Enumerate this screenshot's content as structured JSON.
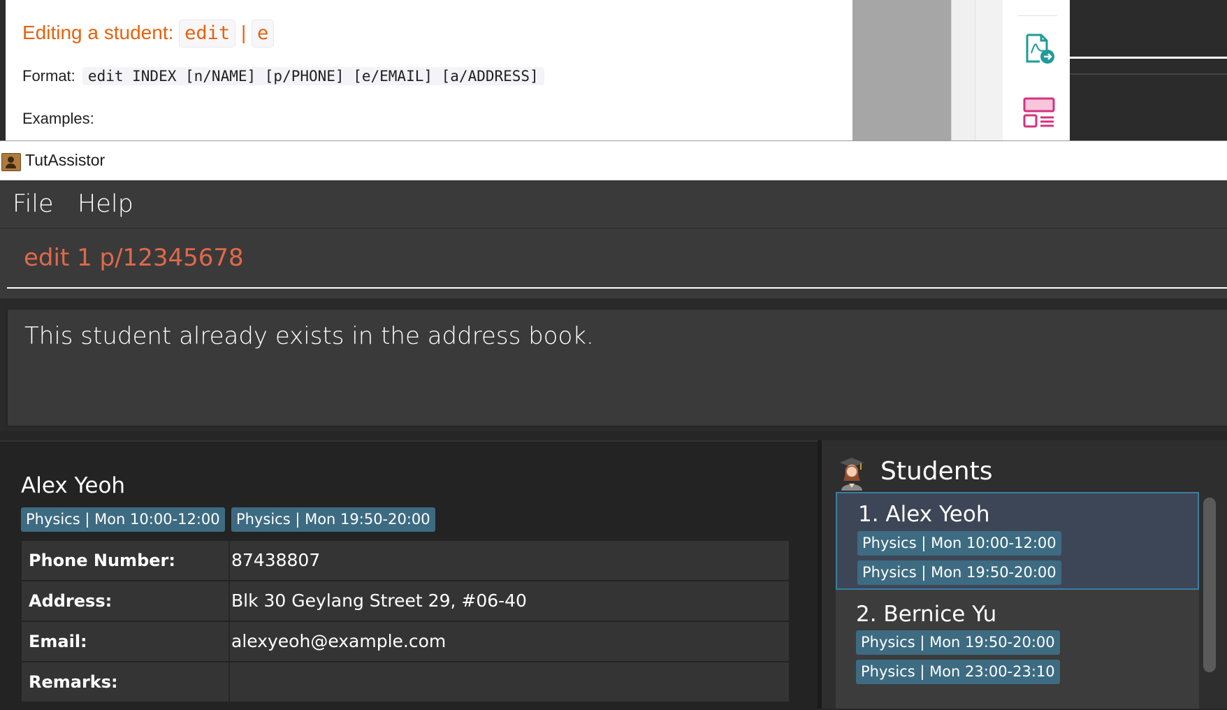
{
  "user_guide": {
    "heading_text": "Editing a student:",
    "heading_code_1": "edit",
    "heading_sep": "|",
    "heading_code_2": "e",
    "format_label": "Format:",
    "format_code": "edit INDEX [n/NAME] [p/PHONE] [e/EMAIL] [a/ADDRESS]",
    "examples_label": "Examples:",
    "side_icons": [
      "pdf-export-icon",
      "layout-icon"
    ]
  },
  "window": {
    "title": "TutAssistor"
  },
  "menu": {
    "items": [
      "File",
      "Help"
    ]
  },
  "command": {
    "value": "edit 1 p/12345678"
  },
  "result": {
    "message": "This student already exists in the address book."
  },
  "details": {
    "name": "Alex Yeoh",
    "tags": [
      "Physics | Mon 10:00-12:00",
      "Physics | Mon 19:50-20:00"
    ],
    "rows": [
      {
        "label": "Phone Number:",
        "value": "87438807"
      },
      {
        "label": "Address:",
        "value": "Blk 30 Geylang Street 29, #06-40"
      },
      {
        "label": "Email:",
        "value": "alexyeoh@example.com"
      },
      {
        "label": "Remarks:",
        "value": ""
      }
    ]
  },
  "students": {
    "title": "Students",
    "list": [
      {
        "name": "1.  Alex Yeoh",
        "tags": [
          "Physics | Mon 10:00-12:00",
          "Physics | Mon 19:50-20:00"
        ],
        "selected": true
      },
      {
        "name": "2.  Bernice Yu",
        "tags": [
          "Physics | Mon 19:50-20:00",
          "Physics | Mon 23:00-23:10"
        ],
        "selected": false
      }
    ]
  },
  "colors": {
    "accent_orange": "#e8610a",
    "command_text": "#e0694a",
    "tag_bg": "#3d6b82",
    "selected_card_bg": "#3d4656",
    "selected_card_border": "#3d7ea0"
  }
}
